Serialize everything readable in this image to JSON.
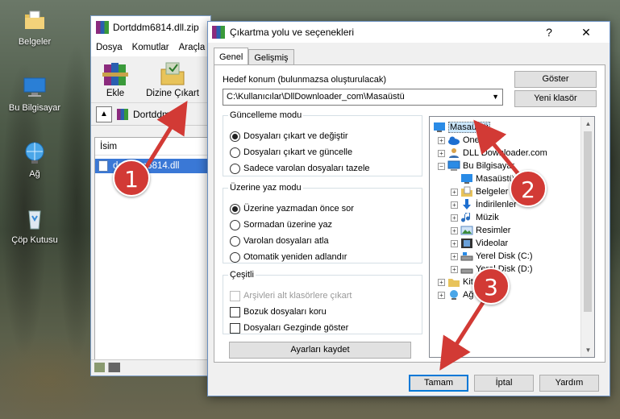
{
  "desktop": {
    "icons": [
      {
        "label": "Belgeler"
      },
      {
        "label": "Bu Bilgisayar"
      },
      {
        "label": "Ağ"
      },
      {
        "label": "Çöp Kutusu"
      }
    ]
  },
  "winrar": {
    "title": "Dortddm6814.dll.zip",
    "menu": [
      "Dosya",
      "Komutlar",
      "Araçla"
    ],
    "toolbar": {
      "add": "Ekle",
      "extract_to": "Dizine Çıkart"
    },
    "address": "Dortddm68",
    "column_name": "İsim",
    "file": "dortddm6814.dll"
  },
  "dialog": {
    "title": "Çıkartma yolu ve seçenekleri",
    "help": "?",
    "close": "✕",
    "tabs": [
      "Genel",
      "Gelişmiş"
    ],
    "dest_label": "Hedef konum (bulunmazsa oluşturulacak)",
    "dest_path": "C:\\Kullanıcılar\\DllDownloader_com\\Masaüstü",
    "show_button": "Göster",
    "new_folder_button": "Yeni klasör",
    "update_group": {
      "legend": "Güncelleme modu",
      "options": [
        "Dosyaları çıkart ve değiştir",
        "Dosyaları çıkart ve güncelle",
        "Sadece varolan dosyaları tazele"
      ]
    },
    "overwrite_group": {
      "legend": "Üzerine yaz modu",
      "options": [
        "Üzerine yazmadan önce sor",
        "Sormadan üzerine yaz",
        "Varolan dosyaları atla",
        "Otomatik yeniden adlandır"
      ]
    },
    "misc_group": {
      "legend": "Çeşitli",
      "options": [
        "Arşivleri alt klasörlere çıkart",
        "Bozuk dosyaları koru",
        "Dosyaları Gezginde göster"
      ]
    },
    "save_settings": "Ayarları kaydet",
    "tree": [
      "Masaüstü",
      "OneDri",
      "DLL Downloader.com",
      "Bu Bilgisayar",
      "Masaüstü",
      "Belgeler",
      "İndirilenler",
      "Müzik",
      "Resimler",
      "Videolar",
      "Yerel Disk (C:)",
      "Yerel Disk (D:)",
      "Kitap",
      "Ağ"
    ],
    "ok": "Tamam",
    "cancel": "İptal",
    "help_button": "Yardım"
  },
  "callouts": [
    "1",
    "2",
    "3"
  ],
  "colors": {
    "callout": "#d23a35",
    "selection": "#3a78d6",
    "primary_border": "#0078d7"
  }
}
